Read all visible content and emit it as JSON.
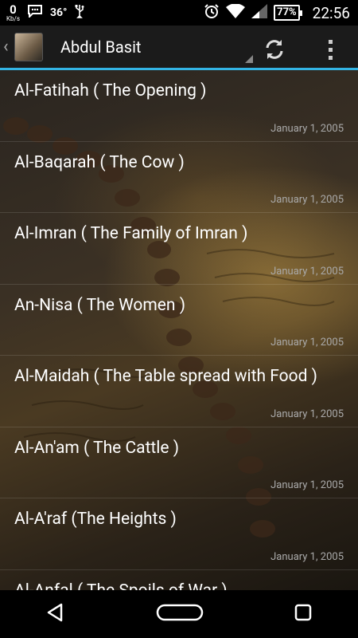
{
  "status_bar": {
    "net_speed": "0",
    "net_unit": "Kb/s",
    "temperature": "36°",
    "battery": "77%",
    "time": "22:56"
  },
  "action_bar": {
    "title": "Abdul Basit"
  },
  "list": [
    {
      "title": "Al-Fatihah ( The Opening )",
      "date": "January 1, 2005"
    },
    {
      "title": "Al-Baqarah ( The Cow )",
      "date": "January 1, 2005"
    },
    {
      "title": "Al-Imran ( The Family of Imran )",
      "date": "January 1, 2005"
    },
    {
      "title": "An-Nisa ( The Women )",
      "date": "January 1, 2005"
    },
    {
      "title": "Al-Maidah ( The Table spread with Food )",
      "date": "January 1, 2005"
    },
    {
      "title": "Al-An'am ( The Cattle )",
      "date": "January 1, 2005"
    },
    {
      "title": "Al-A'raf (The Heights )",
      "date": "January 1, 2005"
    },
    {
      "title": "Al-Anfal ( The Spoils of War )",
      "date": ""
    }
  ],
  "colors": {
    "accent": "#33b5e5",
    "action_bar_bg": "#1b1b1b",
    "date_text": "#aaaaaa"
  }
}
